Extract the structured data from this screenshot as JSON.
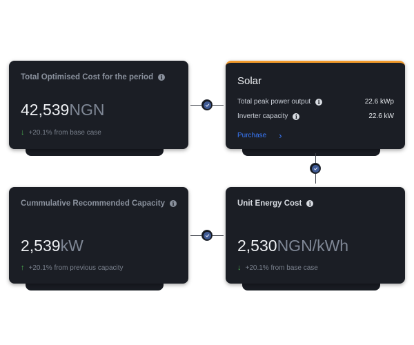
{
  "cards": {
    "cost": {
      "title": "Total Optimised Cost for the period",
      "value": "42,539",
      "unit": "NGN",
      "delta": "+20.1% from base case"
    },
    "solar": {
      "title": "Solar",
      "rows": [
        {
          "label": "Total peak power output",
          "value": "22.6 kWp"
        },
        {
          "label": "Inverter capacity",
          "value": "22.6 kW"
        }
      ],
      "link": "Purchase"
    },
    "capacity": {
      "title": "Cummulative Recommended Capacity",
      "value": "2,539",
      "unit": "kW",
      "delta": "+20.1% from previous capacity"
    },
    "unit_cost": {
      "title": "Unit Energy Cost",
      "value": "2,530",
      "unit": "NGN/kWh",
      "delta": "+20.1% from base case"
    }
  },
  "icons": {
    "info": "i",
    "arrow_down": "↓",
    "arrow_up": "↑",
    "chevron": "›"
  },
  "colors": {
    "card_bg": "#1b1e25",
    "accent": "#f19a2c",
    "link": "#3a7bff",
    "positive": "#4caf50",
    "node": "#3f5a94"
  }
}
